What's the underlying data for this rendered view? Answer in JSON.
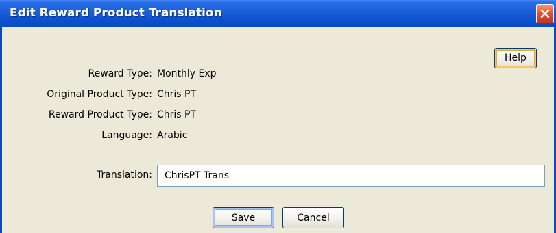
{
  "window": {
    "title": "Edit Reward Product Translation"
  },
  "toolbar": {
    "help_label": "Help"
  },
  "fields": {
    "reward_type": {
      "label": "Reward Type:",
      "value": "Monthly Exp"
    },
    "original_product_type": {
      "label": "Original Product Type:",
      "value": "Chris PT"
    },
    "reward_product_type": {
      "label": "Reward Product Type:",
      "value": "Chris PT"
    },
    "language": {
      "label": "Language:",
      "value": "Arabic"
    },
    "translation": {
      "label": "Translation:",
      "value": "ChrisPT Trans",
      "placeholder": ""
    }
  },
  "actions": {
    "save_label": "Save",
    "cancel_label": "Cancel"
  },
  "colors": {
    "titlebar": "#0a4fce",
    "window_bg": "#ece9d8",
    "close_button": "#e0502c",
    "button_border": "#003c74",
    "input_border": "#7f9db9"
  },
  "icons": {
    "close": "close-icon"
  }
}
